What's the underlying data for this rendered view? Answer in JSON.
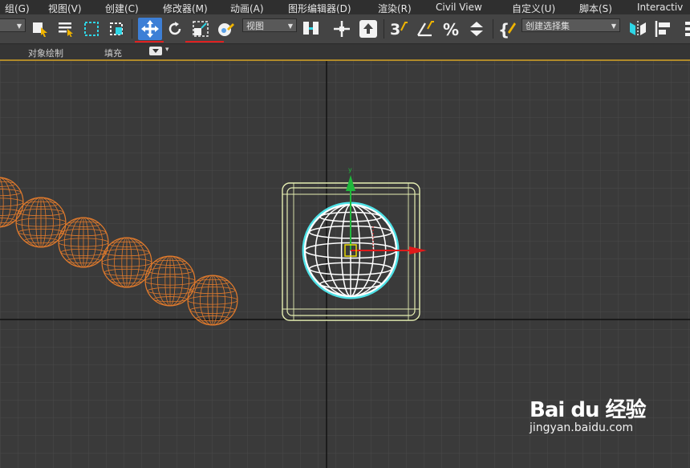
{
  "menubar": {
    "items": [
      "组(G)",
      "视图(V)",
      "创建(C)",
      "修改器(M)",
      "动画(A)",
      "图形编辑器(D)",
      "渲染(R)",
      "Civil View",
      "自定义(U)",
      "脚本(S)",
      "Interactiv"
    ]
  },
  "toolbar": {
    "view_dropdown": "视图",
    "selection_set_dropdown": "创建选择集",
    "active_tool": "select-and-move",
    "highlight_color": "#3d7fd6"
  },
  "ribbon": {
    "tabs": [
      "对象绘制",
      "填充"
    ]
  },
  "watermark": {
    "brand": "Bai du 经验",
    "url": "jingyan.baidu.com"
  },
  "colors": {
    "menu_bg": "#2f2f2f",
    "toolbar_bg": "#444444",
    "viewport_bg": "#3a3a3a",
    "grid": "#4a4a4a",
    "sphere_orange": "#e07a2c",
    "box_yellow": "#e6efb2",
    "sphere_white": "#ffffff",
    "selection_cyan": "#4fe3e8",
    "axis_x": "#e01a1a",
    "axis_y": "#1fb83c"
  }
}
